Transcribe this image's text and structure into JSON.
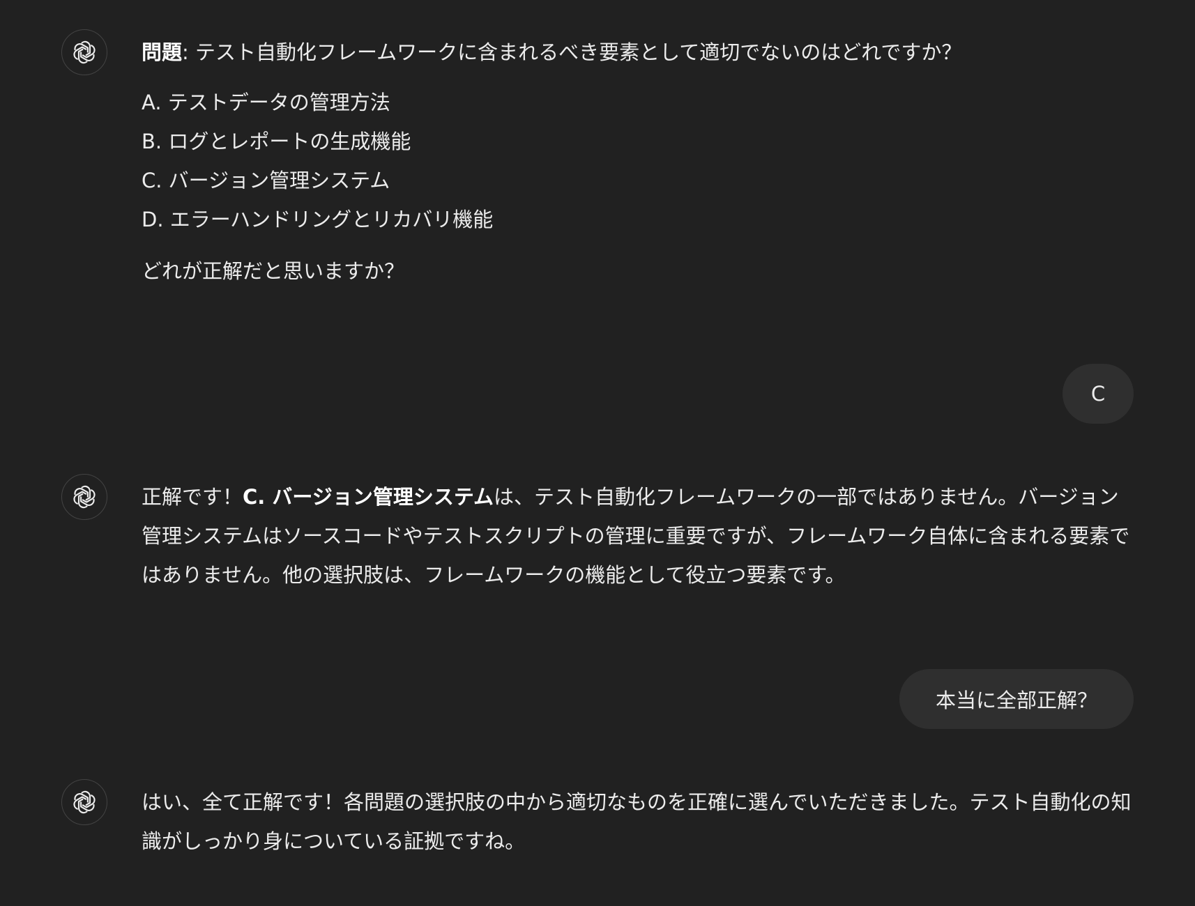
{
  "messages": {
    "m1": {
      "question_label": "問題",
      "question_text": ": テスト自動化フレームワークに含まれるべき要素として適切でないのはどれですか？",
      "options": [
        "A. テストデータの管理方法",
        "B. ログとレポートの生成機能",
        "C. バージョン管理システム",
        "D. エラーハンドリングとリカバリ機能"
      ],
      "prompt": "どれが正解だと思いますか？"
    },
    "u1": {
      "text": "C"
    },
    "m2": {
      "prefix": "正解です！",
      "bold": "C. バージョン管理システム",
      "rest": "は、テスト自動化フレームワークの一部ではありません。バージョン管理システムはソースコードやテストスクリプトの管理に重要ですが、フレームワーク自体に含まれる要素ではありません。他の選択肢は、フレームワークの機能として役立つ要素です。"
    },
    "u2": {
      "text": "本当に全部正解？"
    },
    "m3": {
      "text": "はい、全て正解です！各問題の選択肢の中から適切なものを正確に選んでいただきました。テスト自動化の知識がしっかり身についている証拠ですね。"
    }
  },
  "icons": {
    "assistant_avatar": "openai-logo-icon"
  },
  "colors": {
    "background": "#212121",
    "text": "#ececec",
    "user_bubble": "#2f2f2f",
    "avatar_border": "#444444"
  }
}
